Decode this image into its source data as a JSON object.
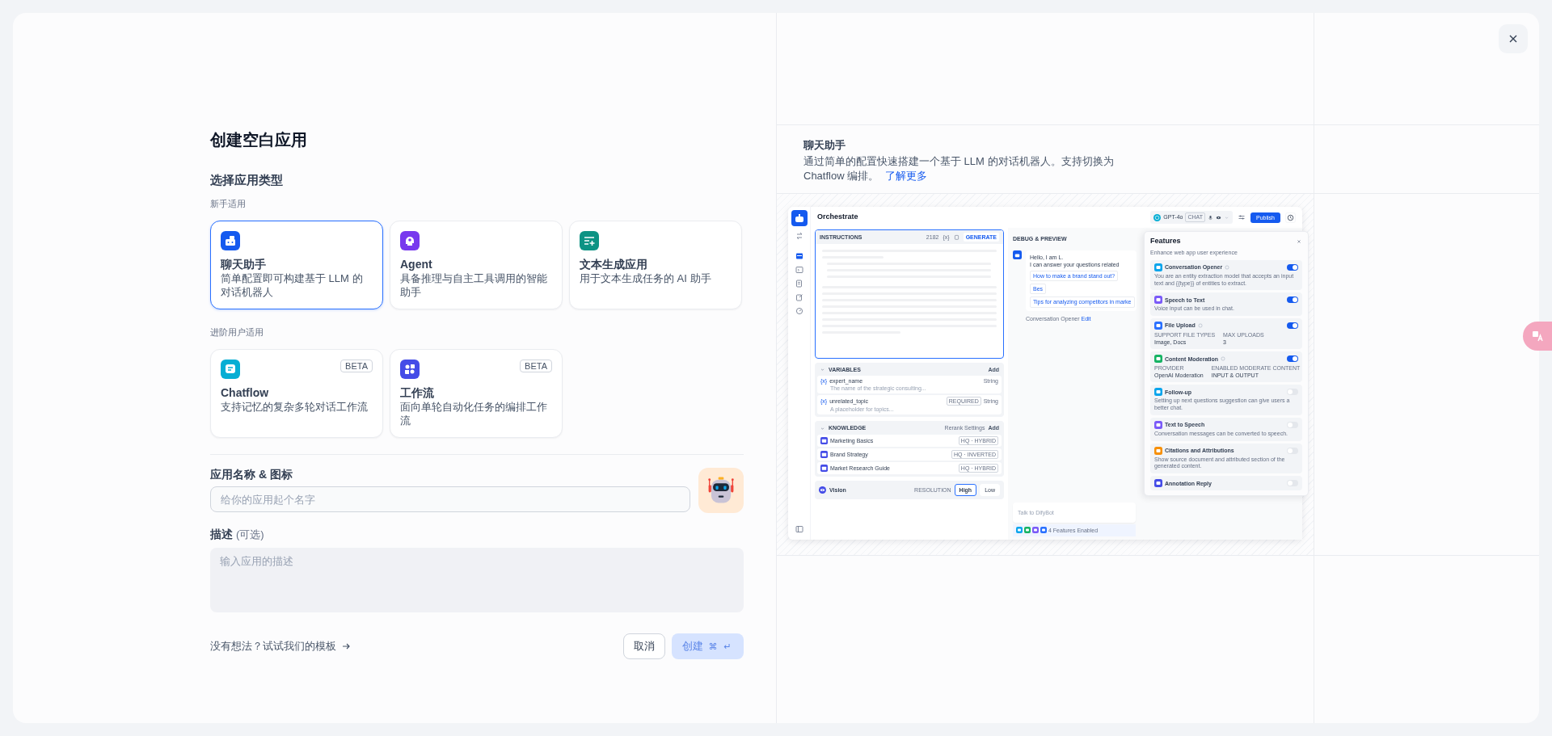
{
  "dialog": {
    "title": "创建空白应用",
    "section_title": "选择应用类型",
    "groups": [
      {
        "label": "新手适用",
        "types": [
          {
            "kind": "chat",
            "name": "聊天助手",
            "description": "简单配置即可构建基于 LLM 的对话机器人",
            "selected": true
          },
          {
            "kind": "agent",
            "name": "Agent",
            "description": "具备推理与自主工具调用的智能助手",
            "selected": false
          },
          {
            "kind": "completion",
            "name": "文本生成应用",
            "description": "用于文本生成任务的 AI 助手",
            "selected": false
          }
        ]
      },
      {
        "label": "进阶用户适用",
        "types": [
          {
            "kind": "chatflow",
            "name": "Chatflow",
            "description": "支持记忆的复杂多轮对话工作流",
            "badge": "BETA",
            "selected": false
          },
          {
            "kind": "workflow",
            "name": "工作流",
            "description": "面向单轮自动化任务的编排工作流",
            "badge": "BETA",
            "selected": false
          }
        ]
      }
    ],
    "name_field": {
      "label": "应用名称 & 图标",
      "placeholder": "给你的应用起个名字"
    },
    "description_field": {
      "label": "描述",
      "hint": "(可选)",
      "placeholder": "输入应用的描述"
    },
    "template_link": "没有想法？试试我们的模板",
    "cancel_button": "取消",
    "create_button": {
      "label": "创建",
      "keys": [
        "⌘",
        "↵"
      ],
      "disabled": true
    }
  },
  "preview": {
    "title": "聊天助手",
    "description": "通过简单的配置快速搭建一个基于 LLM 的对话机器人。支持切换为 Chatflow 编排。",
    "link": "了解更多",
    "screenshot": {
      "title": "Orchestrate",
      "model": {
        "name": "GPT-4o",
        "tag": "CHAT"
      },
      "publish": "Publish",
      "instructions": {
        "label": "INSTRUCTIONS",
        "count": "2182",
        "variable_button": "{x}",
        "generate": "GENERATE"
      },
      "variables": {
        "label": "VARIABLES",
        "add": "Add",
        "items": [
          {
            "prefix": "{x}",
            "name": "expert_name",
            "description": "The name of the strategic consulting...",
            "type": "String"
          },
          {
            "prefix": "{x}",
            "name": "unrelated_topic",
            "description": "A placeholder for topics...",
            "badge": "REQUIRED",
            "type": "String"
          }
        ]
      },
      "knowledge": {
        "label": "KNOWLEDGE",
        "rerank": "Rerank Settings",
        "add": "Add",
        "items": [
          {
            "name": "Marketing Basics",
            "mode": "HQ · HYBRID"
          },
          {
            "name": "Brand Strategy",
            "mode": "HQ · INVERTED"
          },
          {
            "name": "Market Research Guide",
            "mode": "HQ · HYBRID"
          }
        ]
      },
      "vision": {
        "label": "Vision",
        "resolution_label": "RESOLUTION",
        "options": [
          {
            "label": "High",
            "selected": true
          },
          {
            "label": "Low",
            "selected": false
          }
        ]
      },
      "debug": {
        "title": "DEBUG & PREVIEW",
        "greeting": [
          "Hello, I am L.",
          "I can answer your questions related"
        ],
        "suggestions": [
          "How to make a brand stand out?",
          "Bes",
          "Tips for analyzing competitors in marke"
        ],
        "opener": "Conversation Opener",
        "edit": "Edit",
        "input_placeholder": "Talk to DifyBot",
        "features_enabled": "4 Features Enabled"
      },
      "features": {
        "title": "Features",
        "subtitle": "Enhance web app user experience",
        "items": [
          {
            "name": "Conversation Opener",
            "color": "#0ba5ec",
            "help": true,
            "on": true,
            "description": "You are an entity extraction model that accepts an input text and {{type}} of entities to extract."
          },
          {
            "name": "Speech to Text",
            "color": "#7a5af8",
            "help": false,
            "on": true,
            "description": "Voice input can be used in chat."
          },
          {
            "name": "File Upload",
            "color": "#2970ff",
            "help": true,
            "on": true,
            "fields": [
              {
                "label": "SUPPORT FILE TYPES",
                "value": "Image, Docs"
              },
              {
                "label": "MAX UPLOADS",
                "value": "3"
              }
            ]
          },
          {
            "name": "Content Moderation",
            "color": "#16b364",
            "help": true,
            "on": true,
            "fields": [
              {
                "label": "PROVIDER",
                "value": "OpenAI Moderation"
              },
              {
                "label": "ENABLED MODERATE CONTENT",
                "value": "INPUT & OUTPUT"
              }
            ]
          },
          {
            "name": "Follow-up",
            "color": "#0ba5ec",
            "help": false,
            "on": false,
            "description": "Setting up next questions suggestion can give users a better chat."
          },
          {
            "name": "Text to Speech",
            "color": "#7a5af8",
            "help": false,
            "on": false,
            "description": "Conversation messages can be converted to speech."
          },
          {
            "name": "Citations and Attributions",
            "color": "#f79009",
            "help": false,
            "on": false,
            "description": "Show source document and attributed section of the generated content."
          },
          {
            "name": "Annotation Reply",
            "color": "#444ce7",
            "help": false,
            "on": false
          }
        ]
      }
    }
  }
}
